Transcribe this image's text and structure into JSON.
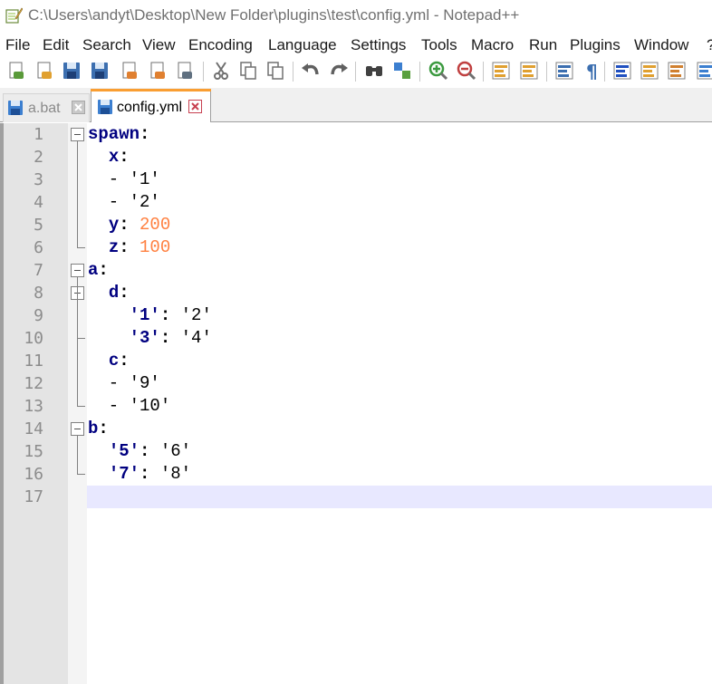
{
  "window": {
    "title": "C:\\Users\\andyt\\Desktop\\New Folder\\plugins\\test\\config.yml - Notepad++"
  },
  "menu": [
    "File",
    "Edit",
    "Search",
    "View",
    "Encoding",
    "Language",
    "Settings",
    "Tools",
    "Macro",
    "Run",
    "Plugins",
    "Window",
    "?"
  ],
  "toolbar": {
    "icons": [
      "new-file-icon",
      "open-file-icon",
      "save-icon",
      "save-all-icon",
      "close-icon",
      "close-all-icon",
      "print-icon",
      "cut-icon",
      "copy-icon",
      "paste-icon",
      "undo-icon",
      "redo-icon",
      "find-icon",
      "replace-icon",
      "zoom-in-icon",
      "zoom-out-icon",
      "sync-vertical-icon",
      "sync-horizontal-icon",
      "word-wrap-icon",
      "show-all-chars-icon",
      "indent-guide-icon",
      "define-language-icon",
      "document-map-icon",
      "function-list-icon"
    ]
  },
  "tabs": [
    {
      "label": "a.bat",
      "active": false
    },
    {
      "label": "config.yml",
      "active": true
    }
  ],
  "editor": {
    "lines": [
      {
        "num": "1",
        "tokens": [
          {
            "t": "key",
            "v": "spawn"
          },
          {
            "t": "punct",
            "v": ":"
          }
        ]
      },
      {
        "num": "2",
        "tokens": [
          {
            "t": "plain",
            "v": "  "
          },
          {
            "t": "key",
            "v": "x"
          },
          {
            "t": "punct",
            "v": ":"
          }
        ]
      },
      {
        "num": "3",
        "tokens": [
          {
            "t": "plain",
            "v": "  - '1'"
          }
        ]
      },
      {
        "num": "4",
        "tokens": [
          {
            "t": "plain",
            "v": "  - '2'"
          }
        ]
      },
      {
        "num": "5",
        "tokens": [
          {
            "t": "plain",
            "v": "  "
          },
          {
            "t": "key",
            "v": "y"
          },
          {
            "t": "punct",
            "v": ":"
          },
          {
            "t": "plain",
            "v": " "
          },
          {
            "t": "num",
            "v": "200"
          }
        ]
      },
      {
        "num": "6",
        "tokens": [
          {
            "t": "plain",
            "v": "  "
          },
          {
            "t": "key",
            "v": "z"
          },
          {
            "t": "punct",
            "v": ":"
          },
          {
            "t": "plain",
            "v": " "
          },
          {
            "t": "num",
            "v": "100"
          }
        ]
      },
      {
        "num": "7",
        "tokens": [
          {
            "t": "key",
            "v": "a"
          },
          {
            "t": "punct",
            "v": ":"
          }
        ]
      },
      {
        "num": "8",
        "tokens": [
          {
            "t": "plain",
            "v": "  "
          },
          {
            "t": "key",
            "v": "d"
          },
          {
            "t": "punct",
            "v": ":"
          }
        ]
      },
      {
        "num": "9",
        "tokens": [
          {
            "t": "plain",
            "v": "    "
          },
          {
            "t": "key",
            "v": "'1'"
          },
          {
            "t": "punct",
            "v": ":"
          },
          {
            "t": "plain",
            "v": " '2'"
          }
        ]
      },
      {
        "num": "10",
        "tokens": [
          {
            "t": "plain",
            "v": "    "
          },
          {
            "t": "key",
            "v": "'3'"
          },
          {
            "t": "punct",
            "v": ":"
          },
          {
            "t": "plain",
            "v": " '4'"
          }
        ]
      },
      {
        "num": "11",
        "tokens": [
          {
            "t": "plain",
            "v": "  "
          },
          {
            "t": "key",
            "v": "c"
          },
          {
            "t": "punct",
            "v": ":"
          }
        ]
      },
      {
        "num": "12",
        "tokens": [
          {
            "t": "plain",
            "v": "  - '9'"
          }
        ]
      },
      {
        "num": "13",
        "tokens": [
          {
            "t": "plain",
            "v": "  - '10'"
          }
        ]
      },
      {
        "num": "14",
        "tokens": [
          {
            "t": "key",
            "v": "b"
          },
          {
            "t": "punct",
            "v": ":"
          }
        ]
      },
      {
        "num": "15",
        "tokens": [
          {
            "t": "plain",
            "v": "  "
          },
          {
            "t": "key",
            "v": "'5'"
          },
          {
            "t": "punct",
            "v": ":"
          },
          {
            "t": "plain",
            "v": " '6'"
          }
        ]
      },
      {
        "num": "16",
        "tokens": [
          {
            "t": "plain",
            "v": "  "
          },
          {
            "t": "key",
            "v": "'7'"
          },
          {
            "t": "punct",
            "v": ":"
          },
          {
            "t": "plain",
            "v": " '8'"
          }
        ]
      },
      {
        "num": "17",
        "tokens": []
      }
    ],
    "current_line": "17",
    "colors": {
      "key": "#000080",
      "number": "#ff8040",
      "current_line_bg": "#e8e8ff",
      "line_number_bg": "#e4e4e4",
      "tab_accent": "#fa9e32"
    }
  }
}
